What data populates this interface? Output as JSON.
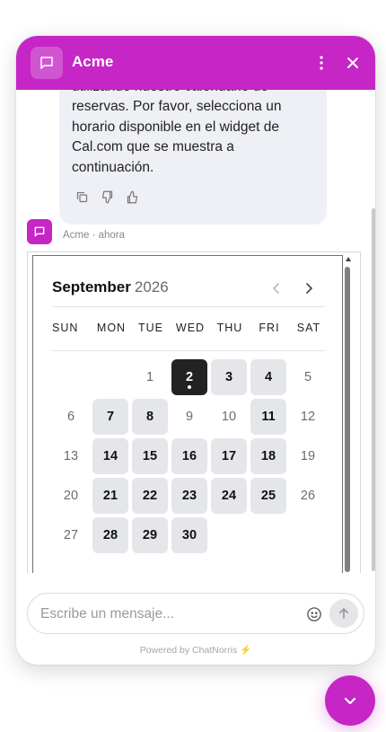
{
  "colors": {
    "brand": "#c526c5",
    "bubble_bg": "#eef0f5",
    "selected_day": "#222222",
    "available_day": "#e5e6e9"
  },
  "header": {
    "title": "Acme",
    "logo_icon": "chat-bubble-icon",
    "menu_icon": "more-vertical-icon",
    "close_icon": "close-icon"
  },
  "message": {
    "text": "utilizando nuestro calendario de reservas. Por favor, selecciona un horario disponible en el widget de Cal.com que se muestra a continuación.",
    "actions": [
      "copy-icon",
      "thumbs-down-icon",
      "thumbs-up-icon"
    ],
    "sender": "Acme",
    "time": "ahora",
    "meta": "Acme · ahora"
  },
  "calendar": {
    "month": "September",
    "year": "2026",
    "weekdays": [
      "SUN",
      "MON",
      "TUE",
      "WED",
      "THU",
      "FRI",
      "SAT"
    ],
    "days": [
      {
        "day": "1",
        "status": "unavailable"
      },
      {
        "day": "2",
        "status": "selected"
      },
      {
        "day": "3",
        "status": "available"
      },
      {
        "day": "4",
        "status": "available"
      },
      {
        "day": "5",
        "status": "unavailable"
      },
      {
        "day": "6",
        "status": "unavailable"
      },
      {
        "day": "7",
        "status": "available"
      },
      {
        "day": "8",
        "status": "available"
      },
      {
        "day": "9",
        "status": "unavailable"
      },
      {
        "day": "10",
        "status": "unavailable"
      },
      {
        "day": "11",
        "status": "available"
      },
      {
        "day": "12",
        "status": "unavailable"
      },
      {
        "day": "13",
        "status": "unavailable"
      },
      {
        "day": "14",
        "status": "available"
      },
      {
        "day": "15",
        "status": "available"
      },
      {
        "day": "16",
        "status": "available"
      },
      {
        "day": "17",
        "status": "available"
      },
      {
        "day": "18",
        "status": "available"
      },
      {
        "day": "19",
        "status": "unavailable"
      },
      {
        "day": "20",
        "status": "unavailable"
      },
      {
        "day": "21",
        "status": "available"
      },
      {
        "day": "22",
        "status": "available"
      },
      {
        "day": "23",
        "status": "available"
      },
      {
        "day": "24",
        "status": "available"
      },
      {
        "day": "25",
        "status": "available"
      },
      {
        "day": "26",
        "status": "unavailable"
      },
      {
        "day": "27",
        "status": "unavailable"
      },
      {
        "day": "28",
        "status": "available"
      },
      {
        "day": "29",
        "status": "available"
      },
      {
        "day": "30",
        "status": "available"
      }
    ]
  },
  "composer": {
    "placeholder": "Escribe un mensaje..."
  },
  "footer": {
    "powered_by": "Powered by ChatNorris"
  }
}
